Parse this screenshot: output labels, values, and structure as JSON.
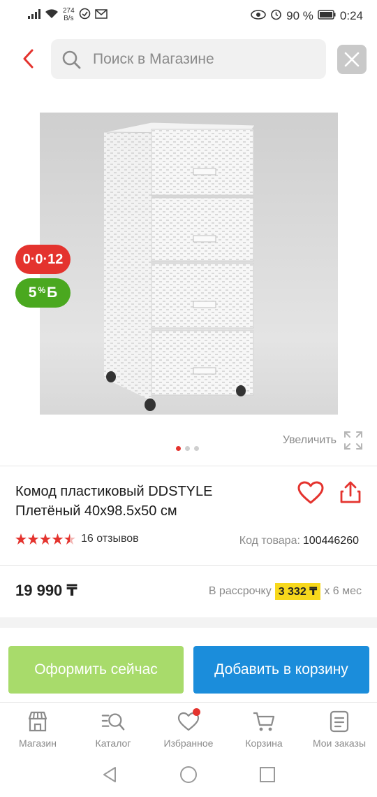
{
  "status_bar": {
    "net_speed_value": "274",
    "net_speed_unit": "B/s",
    "battery": "90 %",
    "time": "0:24"
  },
  "search": {
    "placeholder": "Поиск в Магазине"
  },
  "product": {
    "badge_promo": "0·0·12",
    "badge_bonus_value": "5",
    "badge_bonus_symbol": "%",
    "badge_bonus_letter": "Б",
    "zoom_label": "Увеличить",
    "title": "Комод пластиковый DDSTYLE Плетёный 40x98.5x50 см",
    "rating": 4.5,
    "reviews": "16 отзывов",
    "code_label": "Код товара:",
    "code_value": "100446260",
    "price": "19 990 ₸",
    "installment_label": "В рассрочку",
    "installment_amount": "3 332 ₸",
    "installment_term": "x 6 мес",
    "image_dots": 3,
    "active_dot": 0
  },
  "actions": {
    "buy_now": "Оформить сейчас",
    "add_to_cart": "Добавить в корзину"
  },
  "tabbar": {
    "items": [
      {
        "label": "Магазин",
        "icon": "shop-icon"
      },
      {
        "label": "Каталог",
        "icon": "catalog-search-icon"
      },
      {
        "label": "Избранное",
        "icon": "heart-icon"
      },
      {
        "label": "Корзина",
        "icon": "cart-icon"
      },
      {
        "label": "Мои заказы",
        "icon": "orders-icon"
      }
    ]
  },
  "colors": {
    "accent_red": "#e4332e",
    "bonus_green": "#4aa81f",
    "buy_now_green": "#a8db6b",
    "cart_blue": "#1b8ddb",
    "installment_yellow": "#f7d81c"
  }
}
